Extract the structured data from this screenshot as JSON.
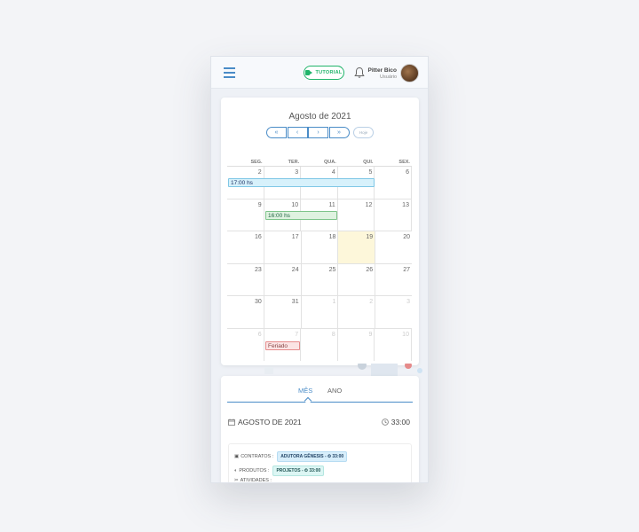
{
  "header": {
    "tutorial_label": "TUTORIAL",
    "user_name": "Pitter Bico",
    "user_role": "Usuário"
  },
  "calendar": {
    "title": "Agosto de 2021",
    "nav": [
      "«",
      "‹",
      "›",
      "»"
    ],
    "today_label": "Hoje",
    "weekdays": [
      "SEG.",
      "TER.",
      "QUA.",
      "QUI.",
      "SEX."
    ],
    "weeks": [
      [
        "2",
        "3",
        "4",
        "5",
        "6"
      ],
      [
        "9",
        "10",
        "11",
        "12",
        "13"
      ],
      [
        "16",
        "17",
        "18",
        "19",
        "20"
      ],
      [
        "23",
        "24",
        "25",
        "26",
        "27"
      ],
      [
        "30",
        "31",
        "1",
        "2",
        "3"
      ],
      [
        "6",
        "7",
        "8",
        "9",
        "10"
      ]
    ],
    "events": {
      "e1": "17:00 hs",
      "e2": "16:00 hs",
      "e3": "Feriado"
    }
  },
  "tabs": [
    "MÊS",
    "ANO"
  ],
  "summary": {
    "month": "AGOSTO DE 2021",
    "total": "33:00",
    "contratos_label": "CONTRATOS :",
    "contratos_tag": "ADUTORA GÊNESIS - ⏲ 33:00",
    "produtos_label": "PRODUTOS :",
    "produtos_tag": "PROJETOS - ⏲ 33:00",
    "atividades_label": "ATIVIDADES :"
  },
  "colors": {
    "accent": "#4a8cc7",
    "tutorial": "#20b46a",
    "today_bg": "#fdf7da"
  }
}
